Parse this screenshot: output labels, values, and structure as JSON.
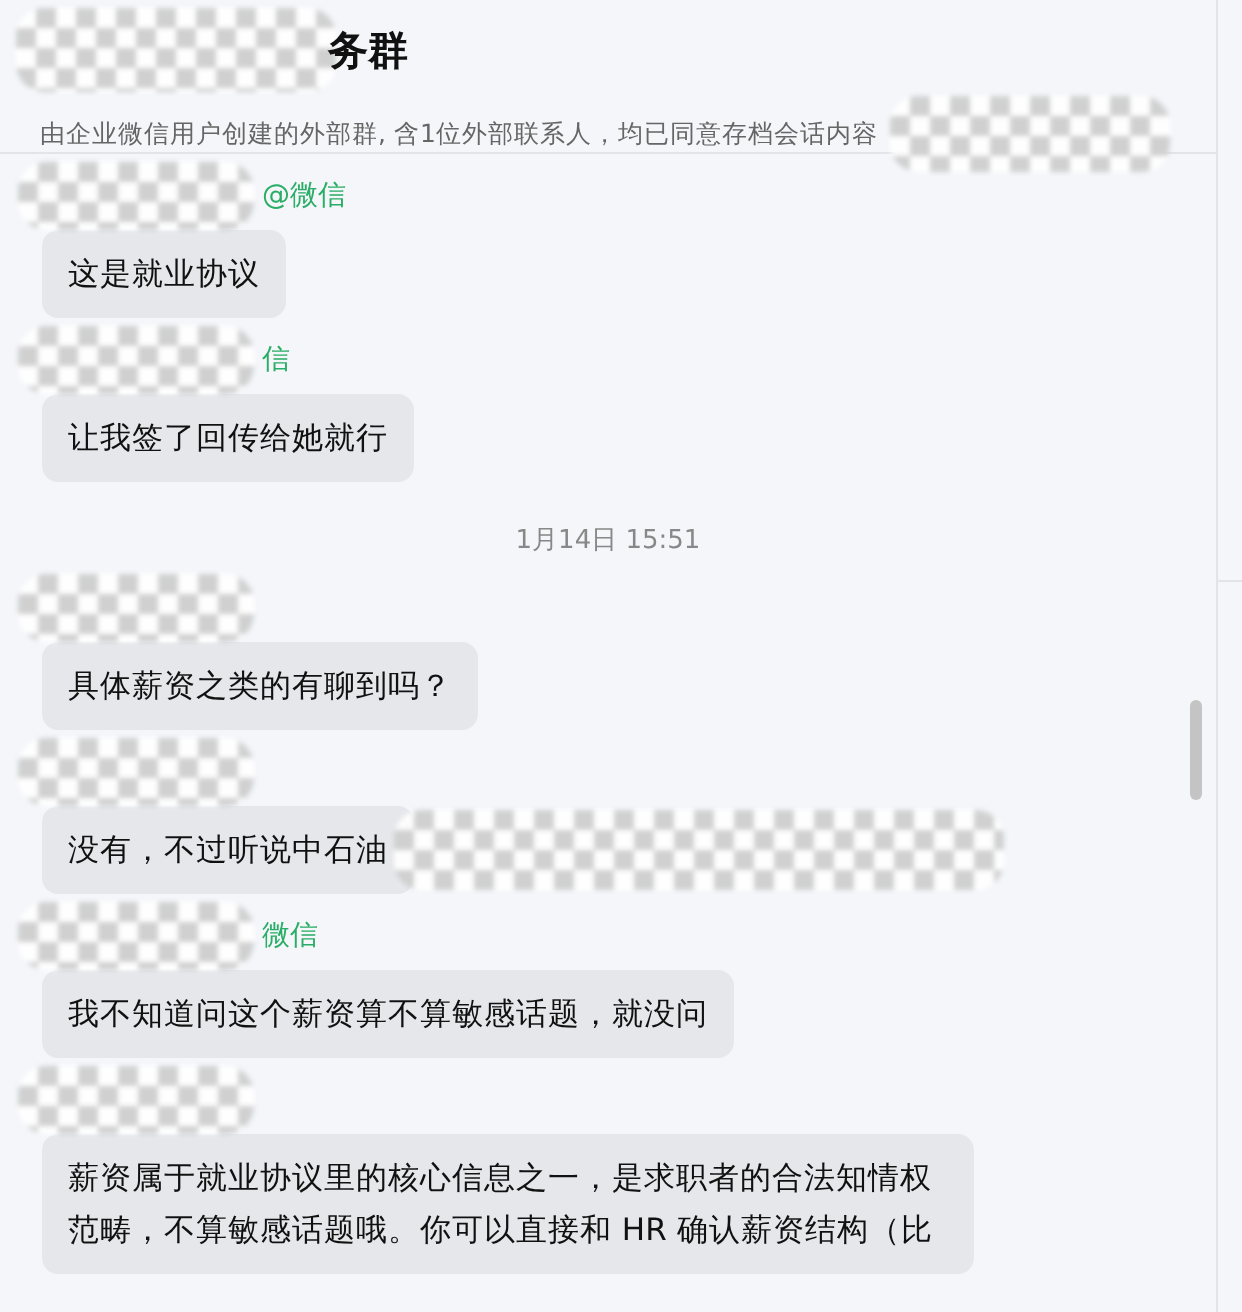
{
  "header": {
    "title": "务群",
    "subtitle": "由企业微信用户创建的外部群, 含1位外部联系人，均已同意存档会话内容"
  },
  "messages": [
    {
      "kind": "message",
      "sender_tag": "@微信",
      "text": "这是就业协议",
      "masked": false
    },
    {
      "kind": "message",
      "sender_tag": "信",
      "text": "让我签了回传给她就行",
      "masked": false
    },
    {
      "kind": "time",
      "text": "1月14日 15:51"
    },
    {
      "kind": "message",
      "text": "具体薪资之类的有聊到吗？",
      "masked": false
    },
    {
      "kind": "message",
      "text": "没有，不过听说中石油",
      "masked": true
    },
    {
      "kind": "message",
      "sender_tag": "微信",
      "text": "我不知道问这个薪资算不算敏感话题，就没问",
      "masked": false
    },
    {
      "kind": "message",
      "text": "薪资属于就业协议里的核心信息之一，是求职者的合法知情权范畴，不算敏感话题哦。你可以直接和 HR 确认薪资结构（比",
      "masked": false
    }
  ]
}
